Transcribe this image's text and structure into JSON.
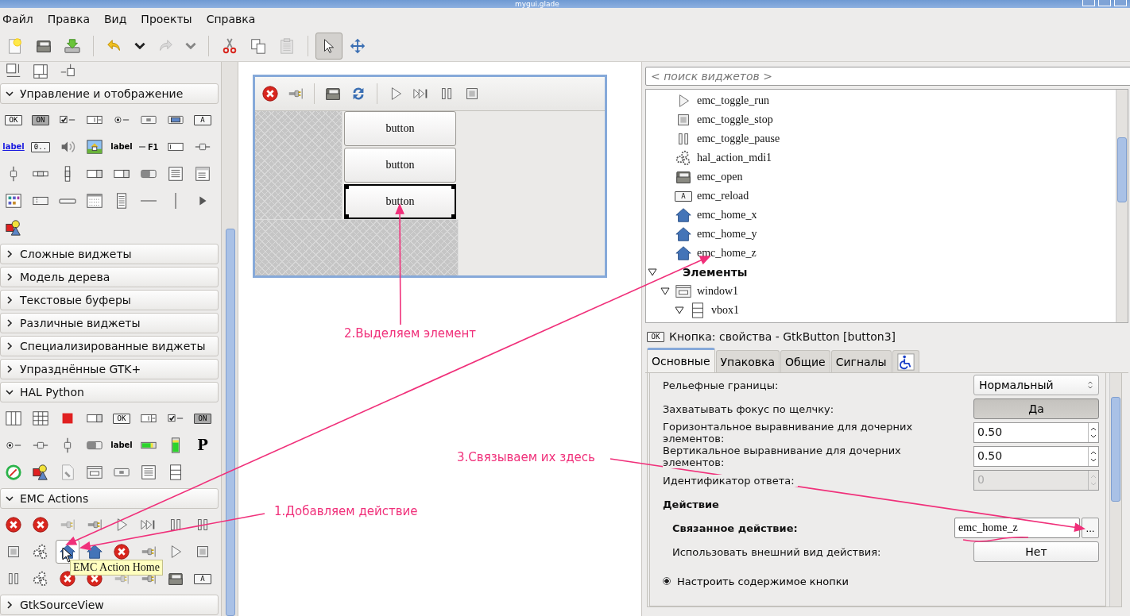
{
  "window": {
    "title": "mygui.glade"
  },
  "menu": [
    {
      "label": "Файл"
    },
    {
      "label": "Правка"
    },
    {
      "label": "Вид"
    },
    {
      "label": "Проекты"
    },
    {
      "label": "Справка"
    }
  ],
  "toolbar": [
    {
      "kind": "new",
      "disabled": false,
      "selected": false
    },
    {
      "kind": "open",
      "disabled": false,
      "selected": false
    },
    {
      "kind": "save",
      "disabled": false,
      "selected": false
    },
    {
      "kind": "separator"
    },
    {
      "kind": "undo",
      "disabled": false,
      "selected": false
    },
    {
      "kind": "dropdown",
      "disabled": false,
      "selected": false
    },
    {
      "kind": "redo",
      "disabled": true,
      "selected": false
    },
    {
      "kind": "dropdown",
      "disabled": true,
      "selected": false
    },
    {
      "kind": "separator"
    },
    {
      "kind": "cut",
      "disabled": false,
      "selected": false
    },
    {
      "kind": "copy",
      "disabled": false,
      "selected": false
    },
    {
      "kind": "paste",
      "disabled": true,
      "selected": false
    },
    {
      "kind": "separator"
    },
    {
      "kind": "pointer",
      "disabled": false,
      "selected": true
    },
    {
      "kind": "move",
      "disabled": false,
      "selected": false
    }
  ],
  "palette": {
    "top_items": [
      {
        "kind": "hsize",
        "selected": false
      },
      {
        "kind": "hbox",
        "selected": false
      },
      {
        "kind": "attach",
        "selected": false
      }
    ],
    "sections": [
      {
        "title": "Управление и отображение",
        "expanded": true,
        "items": [
          {
            "kind": "textbtn",
            "text": "OK",
            "selected": false
          },
          {
            "kind": "toggle",
            "text": "ON",
            "selected": false
          },
          {
            "kind": "check",
            "selected": false
          },
          {
            "kind": "spin",
            "selected": false
          },
          {
            "kind": "radio",
            "selected": false
          },
          {
            "kind": "filebtn",
            "selected": false
          },
          {
            "kind": "colorbtn",
            "selected": false
          },
          {
            "kind": "textbtn",
            "text": "A",
            "selected": false
          },
          {
            "kind": "link",
            "text": "label",
            "selected": false
          },
          {
            "kind": "scalebtn",
            "text": "0..",
            "selected": false
          },
          {
            "kind": "volume",
            "selected": false
          },
          {
            "kind": "image",
            "selected": false
          },
          {
            "kind": "label",
            "text": "label",
            "selected": false
          },
          {
            "kind": "accel",
            "text": "F1",
            "selected": false
          },
          {
            "kind": "entry",
            "selected": false
          },
          {
            "kind": "hscale",
            "selected": false
          },
          {
            "kind": "vscale",
            "selected": false
          },
          {
            "kind": "hscroll",
            "selected": false
          },
          {
            "kind": "vscroll",
            "selected": false
          },
          {
            "kind": "combo",
            "selected": false
          },
          {
            "kind": "combo",
            "selected": false
          },
          {
            "kind": "progress",
            "selected": false
          },
          {
            "kind": "textview",
            "selected": false
          },
          {
            "kind": "treeview",
            "selected": false
          },
          {
            "kind": "iconview",
            "selected": false
          },
          {
            "kind": "statusbar",
            "selected": false
          },
          {
            "kind": "thin",
            "selected": false
          },
          {
            "kind": "calendar",
            "selected": false
          },
          {
            "kind": "list",
            "selected": false
          },
          {
            "kind": "hsep",
            "selected": false
          },
          {
            "kind": "vsep",
            "selected": false
          },
          {
            "kind": "arrow",
            "selected": false
          },
          {
            "kind": "shapes",
            "selected": false
          }
        ]
      },
      {
        "title": "Сложные виджеты",
        "expanded": false
      },
      {
        "title": "Модель дерева",
        "expanded": false
      },
      {
        "title": "Текстовые буферы",
        "expanded": false
      },
      {
        "title": "Различные виджеты",
        "expanded": false
      },
      {
        "title": "Специализированные виджеты",
        "expanded": false
      },
      {
        "title": "Упразднённые GTK+",
        "expanded": false
      },
      {
        "title": "HAL Python",
        "expanded": true,
        "items": [
          {
            "kind": "cols",
            "selected": false
          },
          {
            "kind": "grid",
            "selected": false
          },
          {
            "kind": "redsquare",
            "selected": false
          },
          {
            "kind": "combo",
            "selected": false
          },
          {
            "kind": "textbtn",
            "text": "OK",
            "selected": false
          },
          {
            "kind": "spin",
            "selected": false
          },
          {
            "kind": "check",
            "selected": false
          },
          {
            "kind": "toggle",
            "text": "ON",
            "selected": false
          },
          {
            "kind": "radio",
            "selected": false
          },
          {
            "kind": "hscale",
            "selected": false
          },
          {
            "kind": "vscale",
            "selected": false
          },
          {
            "kind": "progress",
            "selected": false
          },
          {
            "kind": "label",
            "text": "label",
            "selected": false
          },
          {
            "kind": "meterh",
            "selected": false
          },
          {
            "kind": "meterv",
            "selected": false
          },
          {
            "kind": "logo",
            "text": "P",
            "selected": false
          },
          {
            "kind": "dial",
            "selected": false
          },
          {
            "kind": "shapes",
            "selected": false
          },
          {
            "kind": "doc",
            "selected": false
          },
          {
            "kind": "frame",
            "selected": false
          },
          {
            "kind": "filebtn",
            "selected": false
          },
          {
            "kind": "textview",
            "selected": false
          },
          {
            "kind": "rows",
            "selected": false
          }
        ]
      },
      {
        "title": "EMC Actions",
        "expanded": true,
        "items": [
          {
            "kind": "stopx",
            "selected": false
          },
          {
            "kind": "stopx",
            "selected": false
          },
          {
            "kind": "plugoff",
            "selected": false
          },
          {
            "kind": "plug",
            "selected": false
          },
          {
            "kind": "play",
            "selected": false
          },
          {
            "kind": "step",
            "selected": false
          },
          {
            "kind": "pause",
            "selected": false
          },
          {
            "kind": "pause",
            "selected": false
          },
          {
            "kind": "stop",
            "selected": false
          },
          {
            "kind": "gears",
            "selected": false
          },
          {
            "kind": "home",
            "selected": true
          },
          {
            "kind": "home",
            "selected": false
          },
          {
            "kind": "stopx",
            "selected": false
          },
          {
            "kind": "plug",
            "selected": false
          },
          {
            "kind": "play",
            "selected": false
          },
          {
            "kind": "stop",
            "selected": false
          },
          {
            "kind": "pause",
            "selected": false
          },
          {
            "kind": "gears",
            "selected": false
          },
          {
            "kind": "stopx",
            "selected": false
          },
          {
            "kind": "stopx",
            "selected": false
          },
          {
            "kind": "plugoff",
            "selected": false
          },
          {
            "kind": "plug",
            "selected": false
          },
          {
            "kind": "folder",
            "selected": false
          },
          {
            "kind": "textbtn",
            "text": "A",
            "selected": false
          }
        ]
      },
      {
        "title": "GtkSourceView",
        "expanded": false
      }
    ],
    "tooltip": "EMC Action Home"
  },
  "preview": {
    "toolbar": [
      {
        "kind": "stopx"
      },
      {
        "kind": "plug"
      },
      {
        "kind": "separator"
      },
      {
        "kind": "folder"
      },
      {
        "kind": "refresh"
      },
      {
        "kind": "separator"
      },
      {
        "kind": "play"
      },
      {
        "kind": "step"
      },
      {
        "kind": "pause"
      },
      {
        "kind": "stop"
      }
    ],
    "buttons": [
      {
        "label": "button",
        "selected": false
      },
      {
        "label": "button",
        "selected": false
      },
      {
        "label": "button",
        "selected": true
      }
    ]
  },
  "search": {
    "placeholder": "< поиск виджетов >"
  },
  "tree": {
    "items": [
      {
        "kind": "play",
        "label": "emc_toggle_run"
      },
      {
        "kind": "stop",
        "label": "emc_toggle_stop"
      },
      {
        "kind": "pause",
        "label": "emc_toggle_pause"
      },
      {
        "kind": "gears",
        "label": "hal_action_mdi1"
      },
      {
        "kind": "folder",
        "label": "emc_open"
      },
      {
        "kind": "textbtn",
        "text": "A",
        "label": "emc_reload"
      },
      {
        "kind": "home",
        "label": "emc_home_x"
      },
      {
        "kind": "home",
        "label": "emc_home_y"
      },
      {
        "kind": "home",
        "label": "emc_home_z"
      }
    ],
    "nodes": [
      {
        "label": "Элементы",
        "expanded": true,
        "children": [
          {
            "kind": "window",
            "label": "window1",
            "expanded": true,
            "children": [
              {
                "kind": "vbox",
                "label": "vbox1",
                "expanded": true
              }
            ]
          }
        ]
      }
    ]
  },
  "properties": {
    "icon_text": "OK",
    "title": "Кнопка: свойства - GtkButton [button3]",
    "tabs": [
      {
        "kind": "text",
        "label": "Основные",
        "selected": true
      },
      {
        "kind": "text",
        "label": "Упаковка",
        "selected": false
      },
      {
        "kind": "text",
        "label": "Общие",
        "selected": false
      },
      {
        "kind": "text",
        "label": "Сигналы",
        "selected": false
      },
      {
        "kind": "accessibility",
        "selected": false
      }
    ],
    "rows": [
      {
        "kind": "combo",
        "label": "Рельефные границы:",
        "value": "Нормальный"
      },
      {
        "kind": "toggle",
        "label": "Захватывать фокус по щелчку:",
        "value": "Да",
        "on": true
      },
      {
        "kind": "spin",
        "label": "Горизонтальное выравнивание для дочерних элементов:",
        "value": "0.50",
        "disabled": false
      },
      {
        "kind": "spin",
        "label": "Вертикальное выравнивание для дочерних элементов:",
        "value": "0.50",
        "disabled": false
      },
      {
        "kind": "spin",
        "label": "Идентификатор ответа:",
        "value": "0",
        "disabled": true
      },
      {
        "kind": "heading",
        "label": "Действие"
      },
      {
        "kind": "action",
        "label": "Связанное действие:",
        "value": "emc_home_z",
        "button": "..."
      },
      {
        "kind": "toggle",
        "label": "Использовать внешний вид действия:",
        "value": "Нет",
        "on": false
      },
      {
        "kind": "radio",
        "label": "Настроить содержимое кнопки",
        "selected": true
      }
    ]
  },
  "annotations": [
    {
      "text": "2.Выделяем элемент"
    },
    {
      "text": "3.Связываем их здесь"
    },
    {
      "text": "1.Добавляем действие"
    }
  ]
}
